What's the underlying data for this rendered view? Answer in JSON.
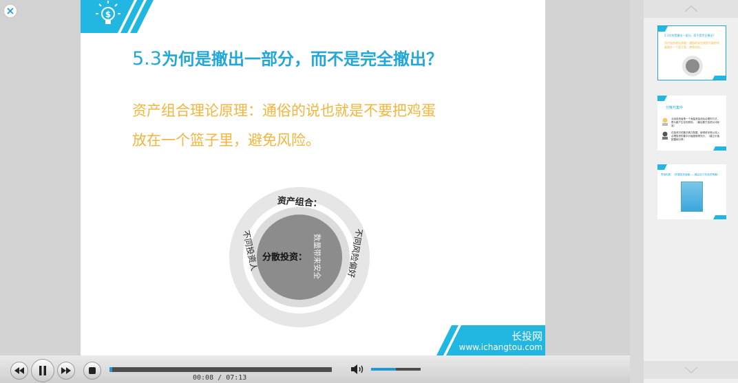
{
  "player": {
    "current_time": "00:08",
    "separator": "/",
    "total_time": "07:13",
    "progress_fraction": 0.012,
    "volume_fraction": 0.5
  },
  "slide": {
    "title_number": "5.3",
    "title_text": "为何是撤出一部分，而不是完全撤出？",
    "body_line1": "资产组合理论原理：通俗的说也就是不要把鸡蛋",
    "body_line2": "放在一个篮子里，避免风险。",
    "diagram": {
      "top_label": "资产组合：",
      "left_label": "不同投资人",
      "right_label": "不同风险偏好",
      "center_label": "分散投资：",
      "center_vertical": "数量带来安全"
    },
    "brand_cn": "长投网",
    "brand_url": "www.ichangtou.com"
  },
  "thumbnails": [
    {
      "title": "5.3为何是撤出一部分，而不是完全撤出？",
      "body": "资产组合理论原理：通俗的说也就是不要把鸡蛋放在一个篮子里，避免风险。"
    },
    {
      "title": "分散与集中",
      "row1": "业余投资者是一个海量资金池及合理的方式，是为散户生存的原则。（最佳基于投资对冲标准）",
      "row2": "在投资中的集中精力配置，使得资本得以流入合理投资的集中价值度使得充分，（建立价值配置和分享）"
    },
    {
      "title": "思维拓展：《挖掘投资宝藏——最会买ST的投资策略》"
    }
  ],
  "colors": {
    "accent_blue": "#22a8d6",
    "body_orange": "#f3b53c",
    "progress_blue": "#1f98d6"
  },
  "icons": [
    "close-icon",
    "lightbulb-dollar-icon",
    "rewind-icon",
    "pause-icon",
    "fast-forward-icon",
    "stop-icon",
    "volume-icon",
    "chevron-up-icon",
    "chevron-down-icon"
  ]
}
